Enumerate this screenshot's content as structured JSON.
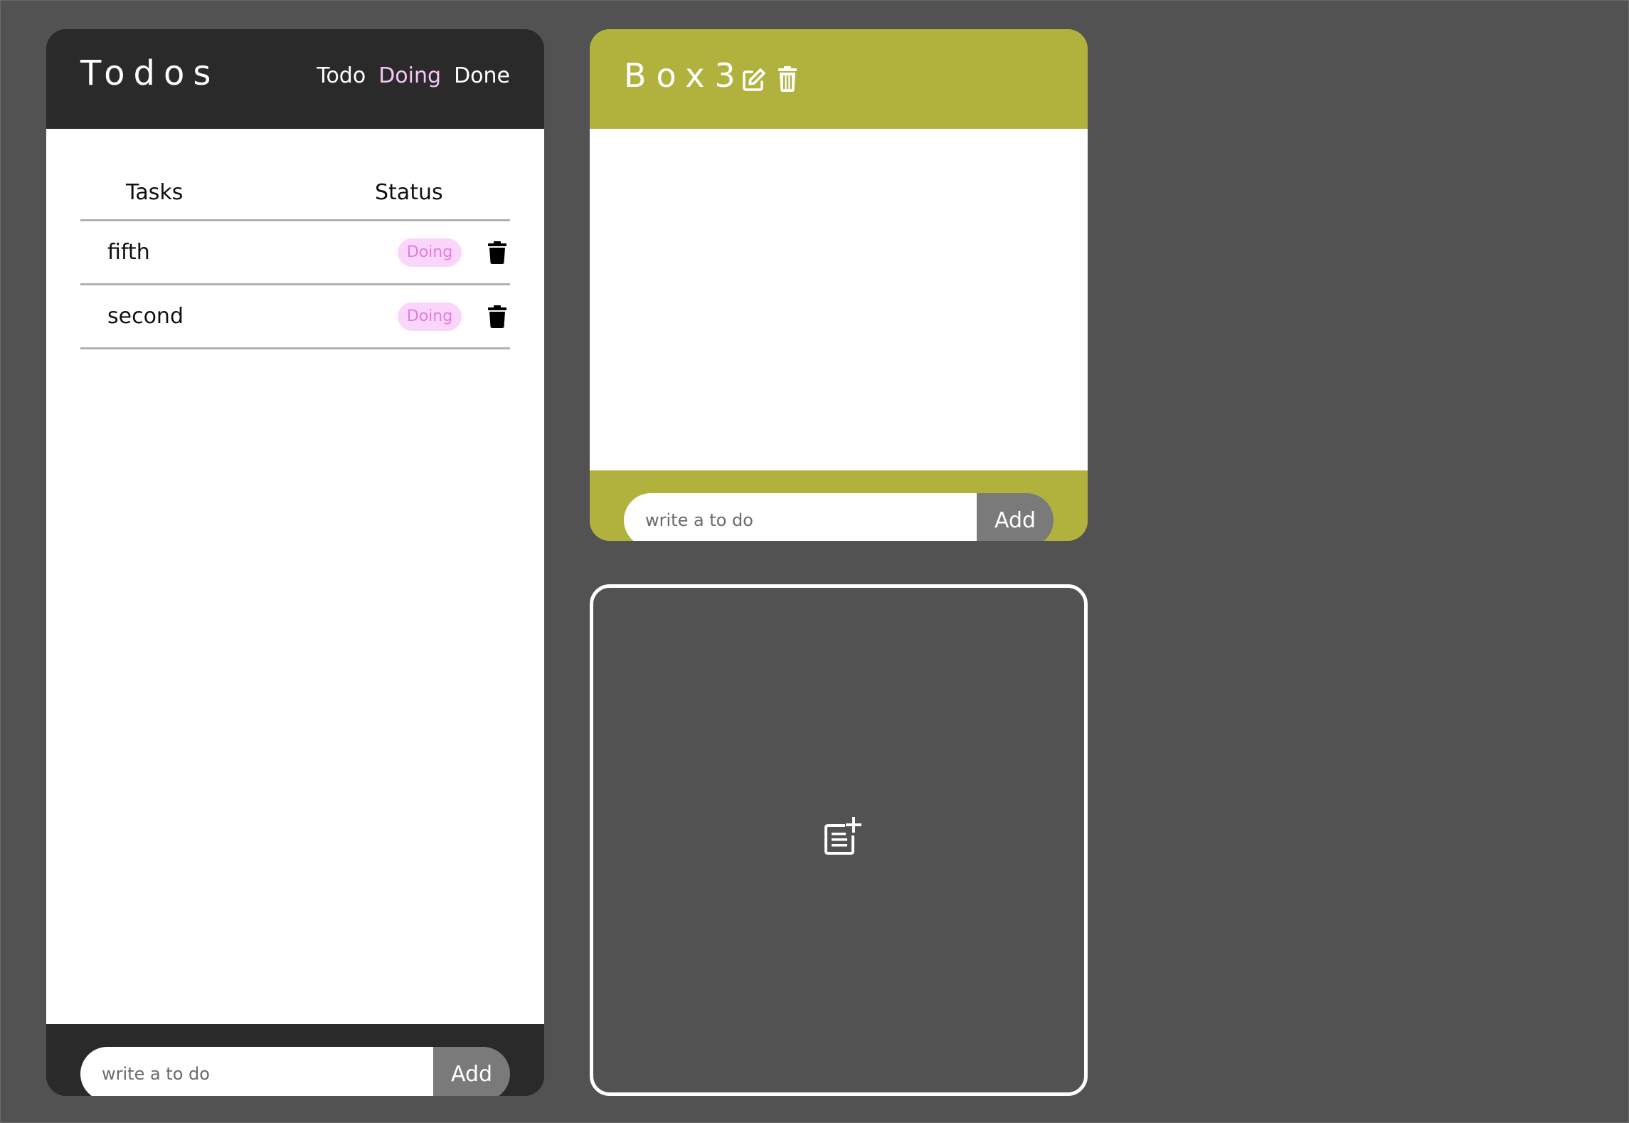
{
  "todos": {
    "title": "Todos",
    "filters": [
      {
        "label": "Todo",
        "active": false
      },
      {
        "label": "Doing",
        "active": true
      },
      {
        "label": "Done",
        "active": false
      }
    ],
    "columns": {
      "tasks": "Tasks",
      "status": "Status"
    },
    "tasks": [
      {
        "name": "fifth",
        "status": "Doing"
      },
      {
        "name": "second",
        "status": "Doing"
      }
    ],
    "input": {
      "placeholder": "write a to do",
      "value": ""
    },
    "add_label": "Add"
  },
  "box": {
    "title": "Box3",
    "color": "#b1b23e",
    "icons": [
      "edit-icon",
      "trash-icon"
    ],
    "input": {
      "placeholder": "write a to do",
      "value": ""
    },
    "add_label": "Add"
  },
  "add_box": {
    "icon": "note-add-icon"
  },
  "colors": {
    "background": "#525252",
    "panel_dark": "#2a2a2a",
    "doing_pill_bg": "#fbd6fb",
    "doing_pill_text": "#e47ae4",
    "active_filter": "#f7c5f7",
    "add_button": "#7a7a7a"
  }
}
